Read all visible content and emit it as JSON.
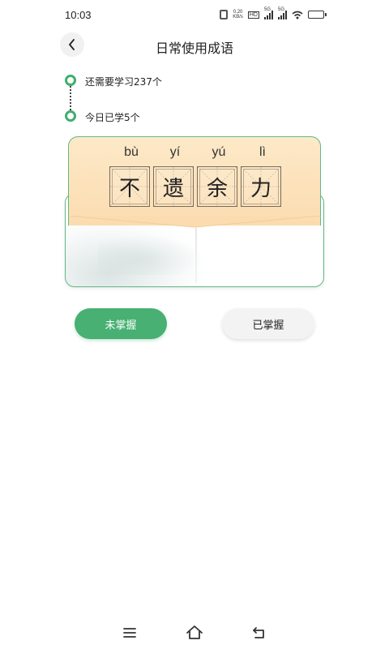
{
  "status_bar": {
    "time": "10:03",
    "net_speed_value": "0.20",
    "net_speed_unit": "KB/s",
    "hd_label": "HD",
    "signal1_label": "5G",
    "signal2_label": "5G",
    "battery_color": "#f2b417"
  },
  "header": {
    "back_icon": "chevron-left-icon",
    "title": "日常使用成语"
  },
  "progress": {
    "remaining_text": "还需要学习237个",
    "today_text": "今日已学5个",
    "accent_color": "#3fae6d"
  },
  "idiom": {
    "characters": [
      {
        "pinyin": "bù",
        "char": "不"
      },
      {
        "pinyin": "yí",
        "char": "遗"
      },
      {
        "pinyin": "yú",
        "char": "余"
      },
      {
        "pinyin": "lì",
        "char": "力"
      }
    ]
  },
  "actions": {
    "unmastered_label": "未掌握",
    "mastered_label": "已掌握",
    "primary_color": "#47b072"
  },
  "nav": {
    "menu_icon": "menu-icon",
    "home_icon": "home-icon",
    "back_icon": "back-arrow-icon"
  }
}
